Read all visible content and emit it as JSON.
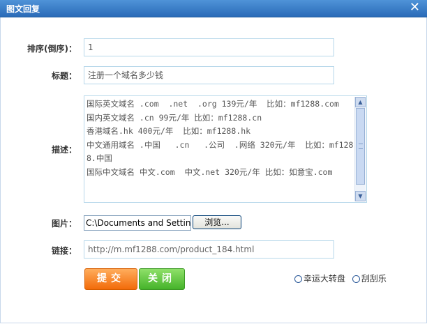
{
  "window": {
    "title": "图文回复",
    "close_icon": "close-icon"
  },
  "form": {
    "order": {
      "label": "排序(倒序)：",
      "value": "1"
    },
    "title": {
      "label": "标题：",
      "value": "注册一个域名多少钱"
    },
    "description": {
      "label": "描述：",
      "lines": [
        "国际英文域名 .com  .net  .org 139元/年  比如：mf1288.com",
        "国内英文域名 .cn 99元/年 比如：mf1288.cn",
        "香港域名.hk 400元/年  比如：mf1288.hk",
        "中文通用域名 .中国   .cn   .公司  .网络 320元/年  比如：mf1288.中国",
        "国际中文域名 中文.com  中文.net 320元/年 比如：如意宝.com"
      ]
    },
    "image": {
      "label": "图片：",
      "file_value": "C:\\Documents and Settings",
      "browse_label": "浏览..."
    },
    "link": {
      "label": "链接：",
      "value": "http://m.mf1288.com/product_184.html"
    }
  },
  "buttons": {
    "submit": "提交",
    "close": "关闭"
  },
  "radios": [
    {
      "label": "幸运大转盘",
      "checked": false
    },
    {
      "label": "刮刮乐",
      "checked": false
    }
  ],
  "colors": {
    "titlebar": "#2a6bb8",
    "submit": "#f26b0a",
    "close": "#45b32a",
    "input_border": "#b6d7ea"
  }
}
